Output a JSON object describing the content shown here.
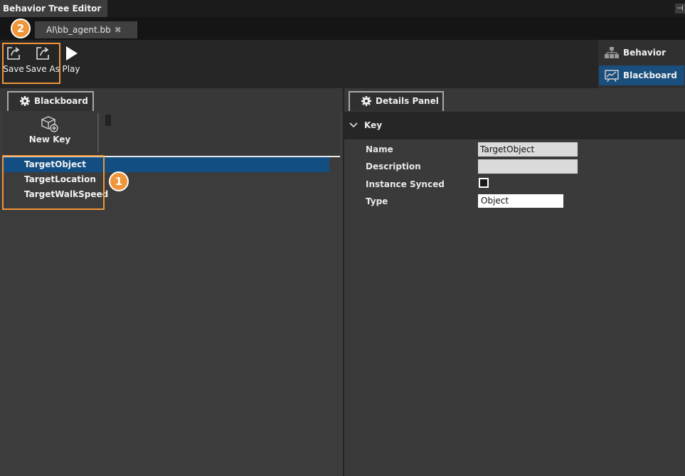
{
  "window": {
    "title": "Behavior Tree Editor",
    "dock_icon": "pin-icon"
  },
  "document_tab": {
    "label": "AI\\bb_agent.bb",
    "close_glyph": "✖"
  },
  "callouts": {
    "one": "1",
    "two": "2"
  },
  "toolbar": {
    "save_label": "Save",
    "save_as_label": "Save As",
    "play_label": "Play"
  },
  "mode_panel": {
    "behavior_tree_label": "Behavior Tree",
    "blackboard_label": "Blackboard",
    "active": "Blackboard"
  },
  "blackboard_panel": {
    "tab_label": "Blackboard",
    "new_key_label": "New Key",
    "keys": [
      "TargetObject",
      "TargetLocation",
      "TargetWalkSpeed"
    ],
    "selected_key": "TargetObject"
  },
  "details_panel": {
    "tab_label": "Details Panel",
    "section_label": "Key",
    "name_label": "Name",
    "name_value": "TargetObject",
    "description_label": "Description",
    "description_value": "",
    "instance_synced_label": "Instance Synced",
    "instance_synced_checked": false,
    "type_label": "Type",
    "type_value": "Object"
  },
  "colors": {
    "accent": "#f0953a",
    "selection": "#134e82",
    "mode_active": "#1a4f7d"
  }
}
